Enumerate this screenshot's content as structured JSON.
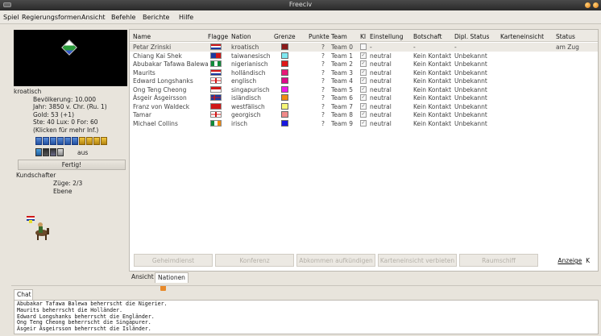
{
  "window": {
    "title": "Freeciv"
  },
  "menu": {
    "items": [
      "Spiel",
      "Regierungsformen",
      "Ansicht",
      "Befehle",
      "Berichte",
      "Hilfe"
    ]
  },
  "info_panel": {
    "nation": "kroatisch",
    "population": "Bevölkerung: 10.000",
    "year": "Jahr: 3850 v. Chr. (Ru. 1)",
    "gold": "Gold: 53 (+1)",
    "tax": "Ste: 40 Lux: 0 For: 60",
    "more_info": "(Klicken für mehr Inf.)",
    "status_text": "aus",
    "done_label": "Fertig!"
  },
  "unit_panel": {
    "unit_name": "Kundschafter",
    "moves": "Züge: 2/3",
    "terrain": "Ebene",
    "icon": "explorer-unit-icon"
  },
  "table": {
    "headers": {
      "name": "Name",
      "flag": "Flagge",
      "nation": "Nation",
      "border": "Grenze",
      "score": "Punkte",
      "team": "Team",
      "ai": "KI",
      "attitude": "Einstellung",
      "embassy": "Botschaft",
      "diplomacy": "Dipl. Status",
      "vision": "Karteneinsicht",
      "status": "Status"
    },
    "rows": [
      {
        "name": "Petar Zrinski",
        "nation": "kroatisch",
        "color": "#8b1a1a",
        "score": "?",
        "team": "Team 0",
        "ai": "",
        "attitude": "-",
        "embassy": "-",
        "diplomacy": "-",
        "status": "am Zug",
        "flag": "flag-croatia"
      },
      {
        "name": "Chiang Kai Shek",
        "nation": "taiwanesisch",
        "color": "#7fe8f0",
        "score": "?",
        "team": "Team 1",
        "ai": "✓",
        "attitude": "neutral",
        "embassy": "Kein Kontakt",
        "diplomacy": "Unbekannt",
        "status": "",
        "flag": "flag-taiwan"
      },
      {
        "name": "Abubakar Tafawa Balewa",
        "nation": "nigerianisch",
        "color": "#e01818",
        "score": "?",
        "team": "Team 2",
        "ai": "✓",
        "attitude": "neutral",
        "embassy": "Kein Kontakt",
        "diplomacy": "Unbekannt",
        "status": "",
        "flag": "flag-nigeria"
      },
      {
        "name": "Maurits",
        "nation": "holländisch",
        "color": "#e81878",
        "score": "?",
        "team": "Team 3",
        "ai": "✓",
        "attitude": "neutral",
        "embassy": "Kein Kontakt",
        "diplomacy": "Unbekannt",
        "status": "",
        "flag": "flag-netherlands"
      },
      {
        "name": "Edward Longshanks",
        "nation": "englisch",
        "color": "#e00a8a",
        "score": "?",
        "team": "Team 4",
        "ai": "✓",
        "attitude": "neutral",
        "embassy": "Kein Kontakt",
        "diplomacy": "Unbekannt",
        "status": "",
        "flag": "flag-england"
      },
      {
        "name": "Ong Teng Cheong",
        "nation": "singapurisch",
        "color": "#f018e8",
        "score": "?",
        "team": "Team 5",
        "ai": "✓",
        "attitude": "neutral",
        "embassy": "Kein Kontakt",
        "diplomacy": "Unbekannt",
        "status": "",
        "flag": "flag-singapore"
      },
      {
        "name": "Ásgeir Ásgeirsson",
        "nation": "isländisch",
        "color": "#f08a10",
        "score": "?",
        "team": "Team 6",
        "ai": "✓",
        "attitude": "neutral",
        "embassy": "Kein Kontakt",
        "diplomacy": "Unbekannt",
        "status": "",
        "flag": "flag-iceland"
      },
      {
        "name": "Franz von Waldeck",
        "nation": "westfälisch",
        "color": "#f8f878",
        "score": "?",
        "team": "Team 7",
        "ai": "✓",
        "attitude": "neutral",
        "embassy": "Kein Kontakt",
        "diplomacy": "Unbekannt",
        "status": "",
        "flag": "flag-westphalia"
      },
      {
        "name": "Tamar",
        "nation": "georgisch",
        "color": "#f08a8a",
        "score": "?",
        "team": "Team 8",
        "ai": "✓",
        "attitude": "neutral",
        "embassy": "Kein Kontakt",
        "diplomacy": "Unbekannt",
        "status": "",
        "flag": "flag-georgia"
      },
      {
        "name": "Michael Collins",
        "nation": "irisch",
        "color": "#1818e0",
        "score": "?",
        "team": "Team 9",
        "ai": "✓",
        "attitude": "neutral",
        "embassy": "Kein Kontakt",
        "diplomacy": "Unbekannt",
        "status": "",
        "flag": "flag-ireland"
      }
    ]
  },
  "buttons": {
    "intelligence": "Geheimdienst",
    "meeting": "Konferenz",
    "cancel_treaty": "Abkommen aufkündigen",
    "withdraw_vision": "Karteneinsicht verbieten",
    "spaceship": "Raumschiff",
    "show": "Anzeige",
    "show_overflow": "K"
  },
  "tabs": {
    "view": "Ansicht",
    "nations": "Nationen"
  },
  "chat": {
    "tab_label": "Chat",
    "lines": [
      "Abubakar Tafawa Balewa beherrscht die Nigerier.",
      "Maurits beherrscht die Holländer.",
      "Edward Longshanks beherrscht die Engländer.",
      "Ong Teng Cheong beherrscht die Singapurer.",
      "Ásgeir Ásgeirsson beherrscht die Isländer."
    ]
  }
}
